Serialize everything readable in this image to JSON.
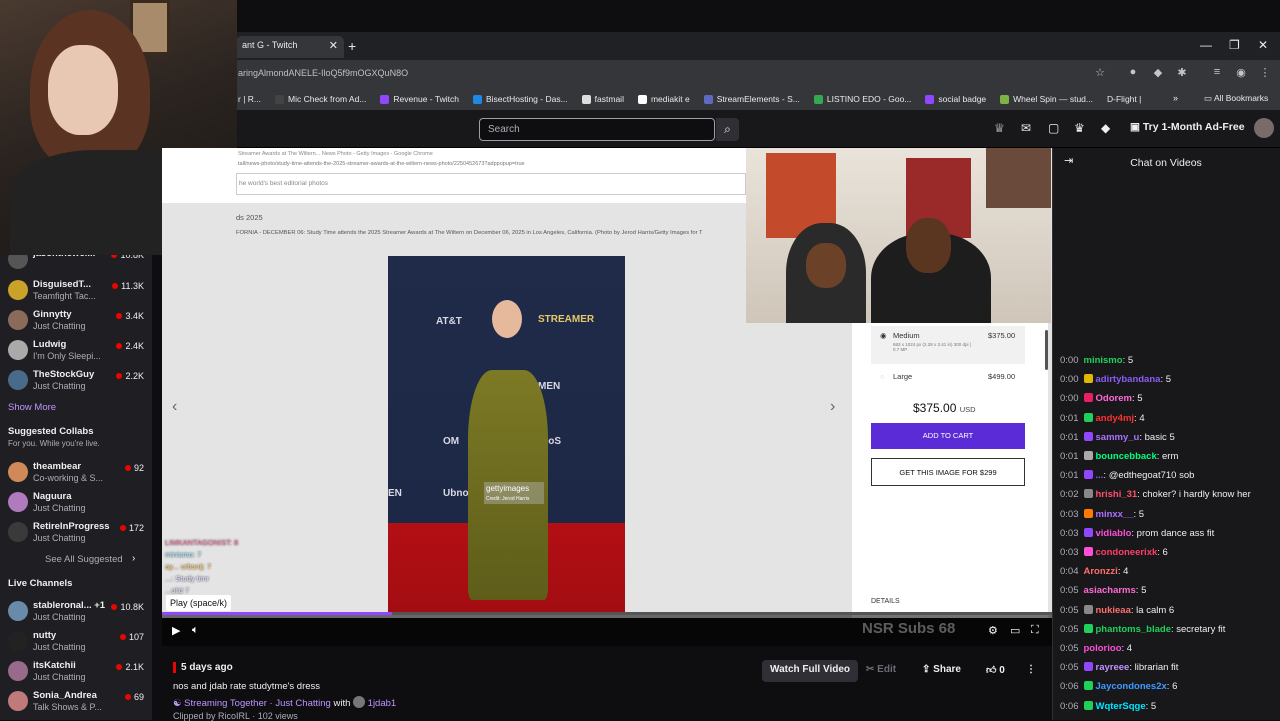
{
  "browser": {
    "tab_title": "ant G - Twitch",
    "url": "aringAlmondANELE-IloQ5f9mOGXQuN8O",
    "bookmarks": [
      "r | R...",
      "Mic Check from Ad...",
      "Revenue - Twitch",
      "BisectHosting - Das...",
      "fastmail",
      "mediakit e",
      "StreamElements - S...",
      "LISTINO EDO - Goo...",
      "social badge",
      "Wheel Spin — stud...",
      "D-Flight |"
    ],
    "all_bookmarks": "All Bookmarks"
  },
  "topnav": {
    "search_placeholder": "Search",
    "ad_free": "Try 1-Month Ad-Free"
  },
  "sidebar": {
    "top_channels": [
      {
        "name": "jasonthewei...",
        "category": "",
        "viewers": "10.8K"
      },
      {
        "name": "DisguisedT...",
        "category": "Teamfight Tac...",
        "viewers": "11.3K"
      },
      {
        "name": "Ginnytty",
        "category": "Just Chatting",
        "viewers": "3.4K"
      },
      {
        "name": "Ludwig",
        "category": "I'm Only Sleepi...",
        "viewers": "2.4K"
      },
      {
        "name": "TheStockGuy",
        "category": "Just Chatting",
        "viewers": "2.2K"
      }
    ],
    "show_more": "Show More",
    "suggested_title": "Suggested Collabs",
    "suggested_sub": "For you. While you're live.",
    "suggested": [
      {
        "name": "theambear",
        "category": "Co-working & S...",
        "viewers": "92"
      },
      {
        "name": "Naguura",
        "category": "Just Chatting",
        "viewers": ""
      },
      {
        "name": "RetireInProgress",
        "category": "Just Chatting",
        "viewers": "172"
      }
    ],
    "see_all": "See All Suggested",
    "live_title": "Live Channels",
    "live": [
      {
        "name": "stableronal... +1",
        "category": "Just Chatting",
        "viewers": "10.8K"
      },
      {
        "name": "nutty",
        "category": "Just Chatting",
        "viewers": "107"
      },
      {
        "name": "itsKatchii",
        "category": "Just Chatting",
        "viewers": "2.1K"
      },
      {
        "name": "Sonia_Andrea",
        "category": "Talk Shows & P...",
        "viewers": "69"
      }
    ]
  },
  "getty": {
    "url": "tall/news-photo/study-time-attends-the-2025-streamer-awards-at-the-wiltern-news-photo/2250452673?adppopup=true",
    "search_hint": "he world's best editorial photos",
    "caption_title": "ds 2025",
    "caption": "FORNIA - DECEMBER 06: Study Time attends the 2025 Streamer Awards at The Wiltern on December 06, 2025 in Los Angeles, California. (Photo by Jerod Harris/Getty Images for T",
    "tab_hint": "Streamer Awards at The Wiltern... News Photo - Getty Images - Google Chrome",
    "option_medium": "Medium",
    "option_medium_price": "$375.00",
    "option_medium_detail": "683 x 1024 px (2.28 x 3.41 in) 300 dpi | 0.7 MP",
    "option_large": "Large",
    "option_large_price": "$499.00",
    "price": "$375.00",
    "currency": "USD",
    "add_to_cart": "ADD TO CART",
    "get_image": "GET THIS IMAGE FOR $299",
    "details": "DETAILS",
    "watermark": "gettyimages",
    "credit": "Credit: Jerod Harris"
  },
  "player": {
    "tooltip": "Play (space/k)",
    "overlay_text": "NSR Subs 68",
    "ghost_chat": [
      "LIMKANTAGONIST: 8",
      "minismo: 7",
      "ay... urbsnij: 7",
      "...: Study timr",
      "...olid 7"
    ]
  },
  "video_info": {
    "age": "5 days ago",
    "title": "nos and jdab rate studytme's dress",
    "tag_streaming": "Streaming Together",
    "tag_category": "Just Chatting",
    "with": "with",
    "partner": "1jdab1",
    "clipped_by": "Clipped by RicoIRL · 102 views",
    "watch_full": "Watch Full Video",
    "edit": "Edit",
    "share": "Share",
    "likes": "0"
  },
  "chat": {
    "header": "Chat on Videos",
    "messages": [
      {
        "time": "0:00",
        "user": "minismo",
        "text": ": 5",
        "color": "#1fd15b",
        "badge": ""
      },
      {
        "time": "0:00",
        "user": "adirtybandana",
        "text": ": 5",
        "color": "#8a5cf5",
        "badge": "#e0b800"
      },
      {
        "time": "0:00",
        "user": "Odorem",
        "text": ": 5",
        "color": "#ff6ad5",
        "badge": "#e91e63"
      },
      {
        "time": "0:01",
        "user": "andy4mj",
        "text": ": 4",
        "color": "#ff2f2f",
        "badge": "#1fd15b"
      },
      {
        "time": "0:01",
        "user": "sammy_u",
        "text": ": basic 5",
        "color": "#a970ff",
        "badge": "#9147ff"
      },
      {
        "time": "0:01",
        "user": "bouncebback",
        "text": ": erm",
        "color": "#00ff7f",
        "badge": "#aaaaaa"
      },
      {
        "time": "0:01",
        "user": "...",
        "text": ": @edthegoat710 sob",
        "color": "#7b68ee",
        "badge": "#9147ff"
      },
      {
        "time": "0:02",
        "user": "hrishi_31",
        "text": ": choker? i hardly know her",
        "color": "#ff4f6d",
        "badge": "#888"
      },
      {
        "time": "0:03",
        "user": "minxx__",
        "text": ": 5",
        "color": "#a970ff",
        "badge": "#ff7a00"
      },
      {
        "time": "0:03",
        "user": "vidiablo",
        "text": ": prom dance ass fit",
        "color": "#ff4fd8",
        "badge": "#9147ff"
      },
      {
        "time": "0:03",
        "user": "condoneerixk",
        "text": ": 6",
        "color": "#ff3d6a",
        "badge": "#ff4fd8"
      },
      {
        "time": "0:04",
        "user": "Aronzzi",
        "text": ": 4",
        "color": "#ff6e6e",
        "badge": ""
      },
      {
        "time": "0:05",
        "user": "asiacharms",
        "text": ": 5",
        "color": "#ff6ad5",
        "badge": ""
      },
      {
        "time": "0:05",
        "user": "nukieaa",
        "text": ": la calm 6",
        "color": "#ff6e6e",
        "badge": "#888"
      },
      {
        "time": "0:05",
        "user": "phantoms_blade",
        "text": ": secretary fit",
        "color": "#1fd15b",
        "badge": "#1fd15b"
      },
      {
        "time": "0:05",
        "user": "polorioo",
        "text": ": 4",
        "color": "#ff4fd8",
        "badge": ""
      },
      {
        "time": "0:05",
        "user": "rayreee",
        "text": ": librarian fit",
        "color": "#bf94ff",
        "badge": "#9147ff"
      },
      {
        "time": "0:06",
        "user": "Jaycondones2x",
        "text": ": 6",
        "color": "#3d9bff",
        "badge": "#1fd15b"
      },
      {
        "time": "0:06",
        "user": "WqterSqge",
        "text": ": 5",
        "color": "#00e5ff",
        "badge": "#1fd15b"
      }
    ]
  }
}
